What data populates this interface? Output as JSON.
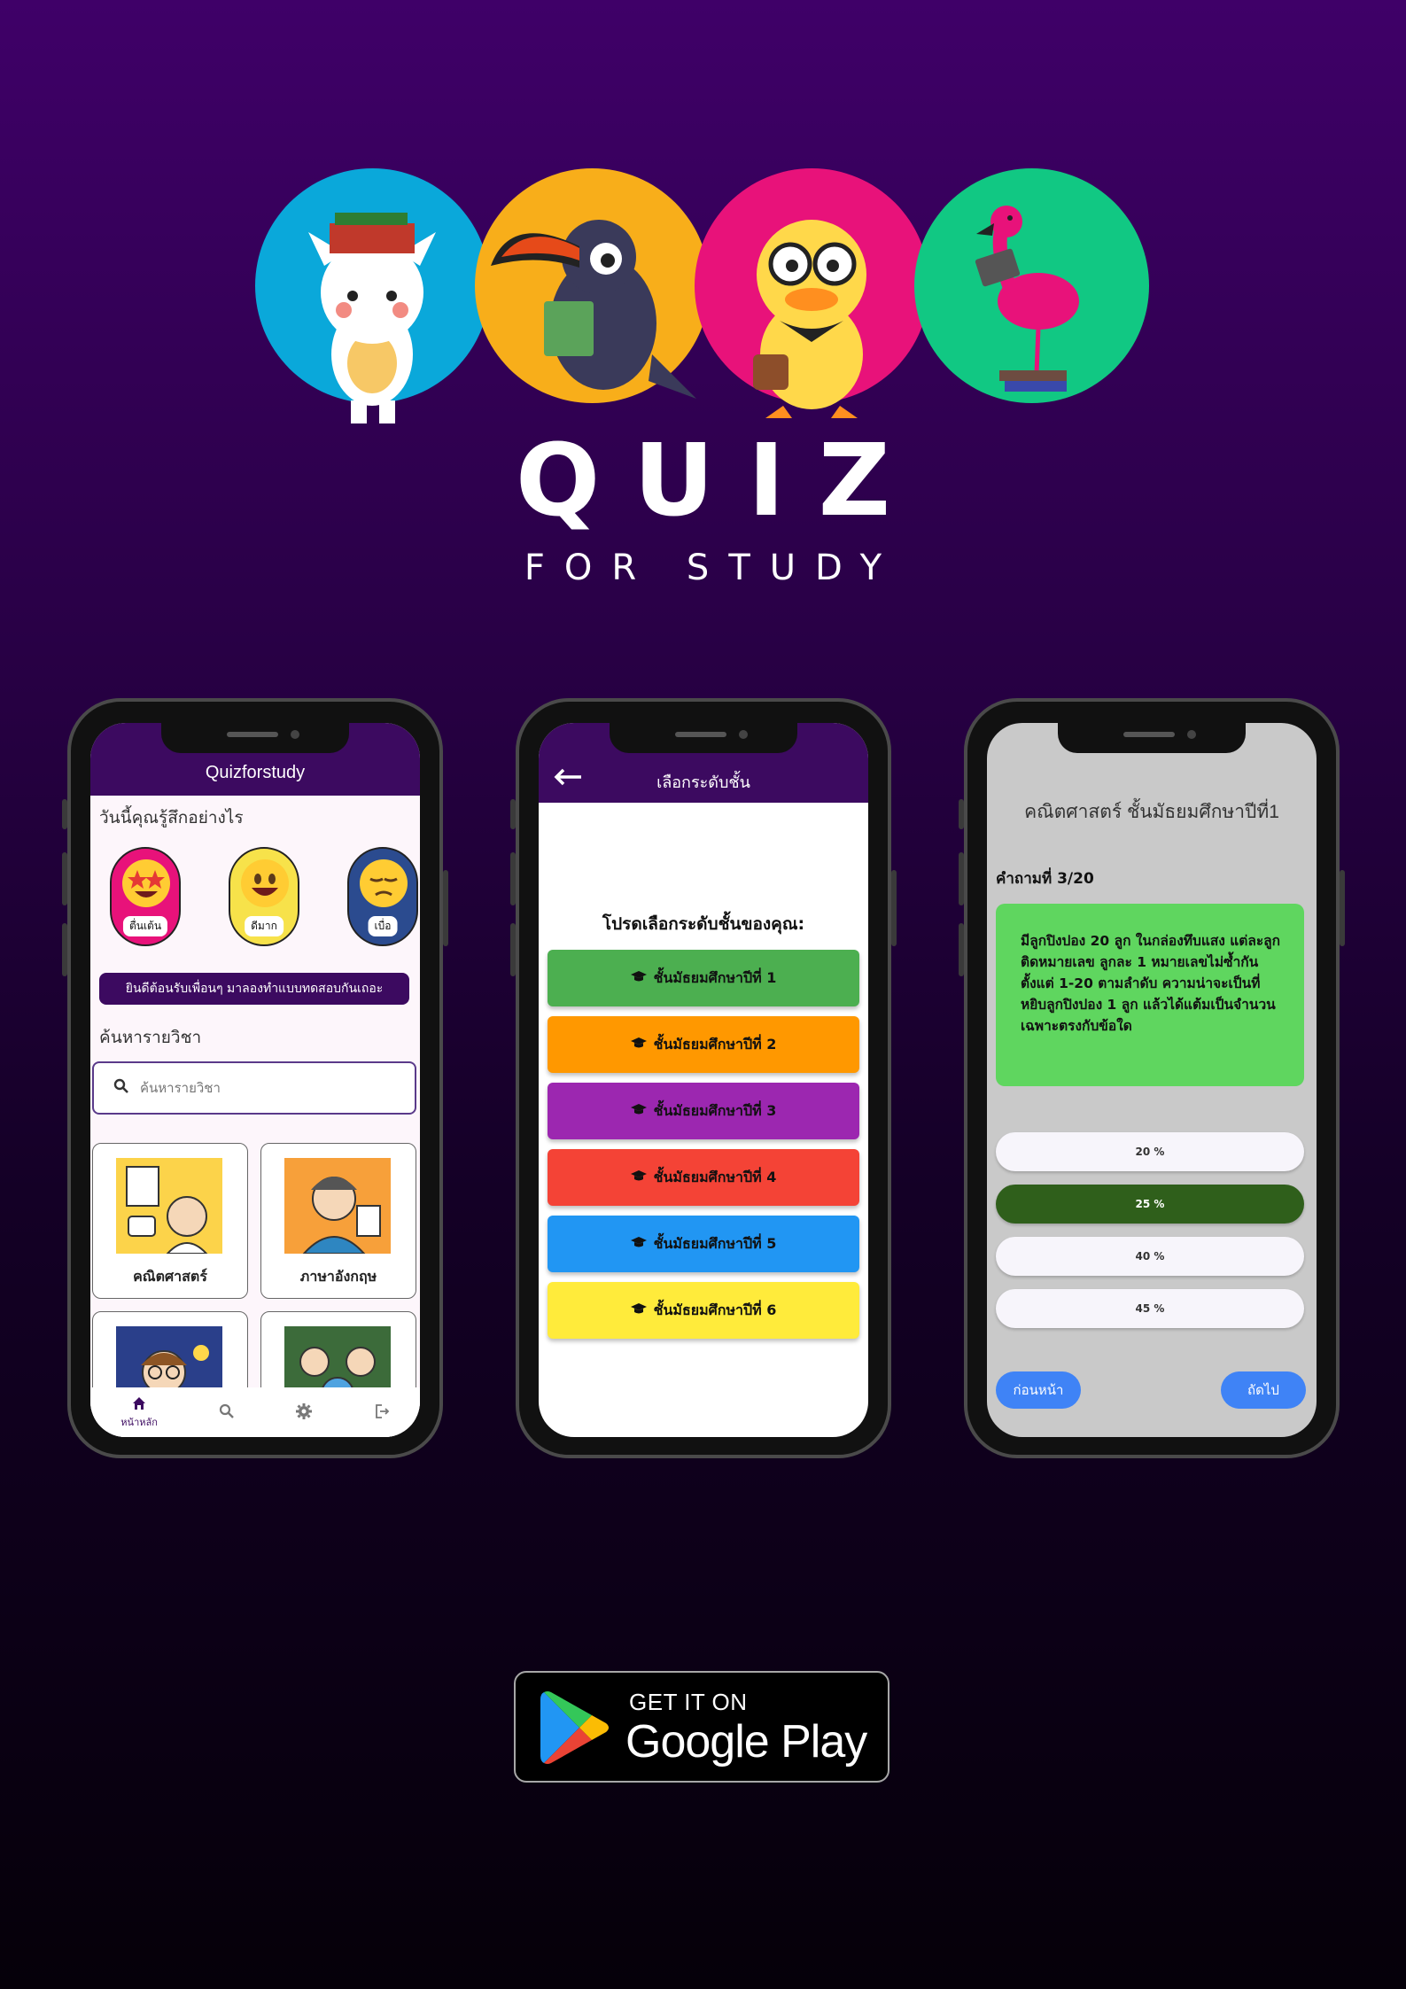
{
  "brand": {
    "title": "QUIZ",
    "subtitle": "FOR STUDY"
  },
  "mascots": [
    "cat",
    "toucan",
    "duck",
    "flamingo"
  ],
  "colors": {
    "bg_top": "#3f0068",
    "bg_bottom": "#050009",
    "app_purple": "#3c0a60",
    "circle_blue": "#0aa8da",
    "circle_orange": "#f8ae1a",
    "circle_pink": "#e8127a",
    "circle_green": "#11c883",
    "accent_blue": "#3f83f6"
  },
  "phone1": {
    "app_title": "Quizforstudy",
    "feel_question": "วันนี้คุณรู้สึกอย่างไร",
    "moods": [
      {
        "label": "ตื่นเต้น",
        "icon": "star-eyes-emoji-icon",
        "color": "#e8127a"
      },
      {
        "label": "ดีมาก",
        "icon": "smile-emoji-icon",
        "color": "#f7e24a"
      },
      {
        "label": "เบื่อ",
        "icon": "bored-emoji-icon",
        "color": "#2b4b8f"
      }
    ],
    "welcome_banner": "ยินดีต้อนรับเพื่อนๆ มาลองทำแบบทดสอบกันเถอะ",
    "search_label": "ค้นหารายวิชา",
    "search_placeholder": "ค้นหารายวิชา",
    "subjects": [
      {
        "label": "คณิตศาสตร์",
        "icon": "math-student-icon",
        "color": "#fcd34a"
      },
      {
        "label": "ภาษาอังกฤษ",
        "icon": "english-student-icon",
        "color": "#f7a03a"
      },
      {
        "label": "",
        "icon": "science-student-icon",
        "color": "#2a3f8a"
      },
      {
        "label": "",
        "icon": "social-student-icon",
        "color": "#3c6b3a"
      }
    ],
    "nav": [
      {
        "label": "หน้าหลัก",
        "icon": "home-icon"
      },
      {
        "label": "",
        "icon": "search-icon"
      },
      {
        "label": "",
        "icon": "gear-icon"
      },
      {
        "label": "",
        "icon": "logout-icon"
      }
    ]
  },
  "phone2": {
    "title": "เลือกระดับชั้น",
    "prompt": "โปรดเลือกระดับชั้นของคุณ:",
    "grades": [
      {
        "label": "ชั้นมัธยมศึกษาปีที่ 1",
        "color": "#4caf50"
      },
      {
        "label": "ชั้นมัธยมศึกษาปีที่  2",
        "color": "#ff9800"
      },
      {
        "label": "ชั้นมัธยมศึกษาปีที่ 3",
        "color": "#9c27b0"
      },
      {
        "label": "ชั้นมัธยมศึกษาปีที่ 4",
        "color": "#f44336"
      },
      {
        "label": "ชั้นมัธยมศึกษาปีที่ 5",
        "color": "#2196f3"
      },
      {
        "label": "ชั้นมัธยมศึกษาปีที่ 6",
        "color": "#ffeb3b"
      }
    ]
  },
  "phone3": {
    "subject": "คณิตศาสตร์ ชั้นมัธยมศึกษาปีที่1",
    "question_number": "คำถามที่ 3/20",
    "question": " มีลูกปิงปอง 20 ลูก ในกล่องทึบแสง แต่ละลูกติดหมายเลข ลูกละ 1 หมายเลขไม่ซ้ำกัน ตั้งแต่ 1-20 ตามลำดับ ความน่าจะเป็นที่หยิบลูกปิงปอง 1 ลูก แล้วได้แต้มเป็นจำนวนเฉพาะตรงกับข้อใด",
    "options": [
      "20 %",
      "25 %",
      "40 %",
      "45 %"
    ],
    "selected_index": 1,
    "prev_label": "ก่อนหน้า",
    "next_label": "ถัดไป"
  },
  "store_badge": {
    "line1": "GET IT ON",
    "line2": "Google Play"
  }
}
